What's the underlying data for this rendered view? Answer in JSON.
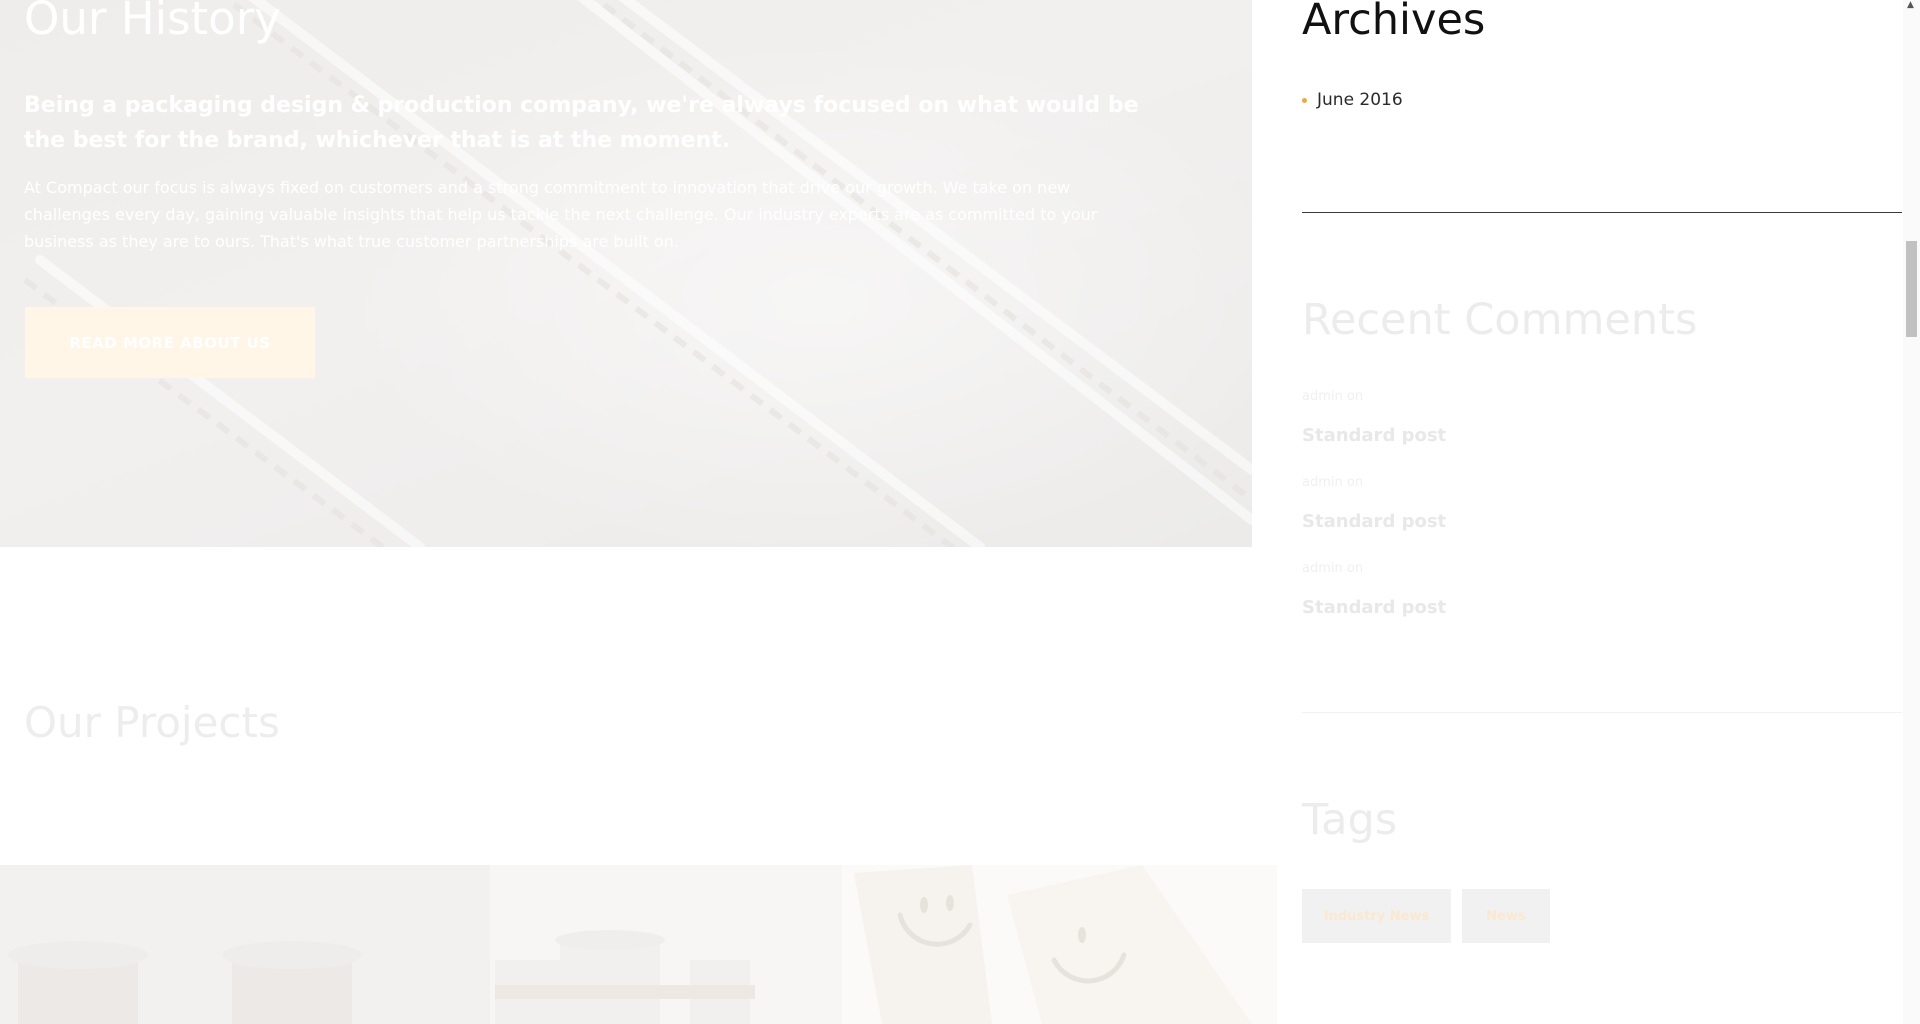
{
  "history": {
    "title": "Our History",
    "lead": "Being a packaging design & production company, we're always focused on what would be the best for the brand, whichever that is at the moment.",
    "body": "At Compact our focus is always fixed on customers and a strong commitment to innovation that drive our growth. We take on new challenges every day, gaining valuable insights that help us tackle the next challenge. Our industry experts are as committed to your business as they are to ours. That's what true customer partnerships are built on.",
    "button_label": "READ MORE ABOUT US"
  },
  "projects": {
    "title": "Our Projects"
  },
  "sidebar": {
    "archives": {
      "title": "Archives",
      "items": [
        {
          "label": "June 2016"
        }
      ]
    },
    "recent_comments": {
      "title": "Recent Comments",
      "items": [
        {
          "author": "admin",
          "on": "on",
          "post": "Standard post"
        },
        {
          "author": "admin",
          "on": "on",
          "post": "Standard post"
        },
        {
          "author": "admin",
          "on": "on",
          "post": "Standard post"
        }
      ]
    },
    "tags": {
      "title": "Tags",
      "items": [
        {
          "label": "Industry News"
        },
        {
          "label": "News"
        }
      ]
    }
  },
  "colors": {
    "accent": "#f0a93b",
    "button_bg": "#fff6e8",
    "tag_bg": "#f1f1f1"
  }
}
